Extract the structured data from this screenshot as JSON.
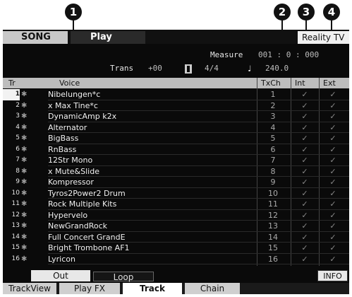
{
  "callouts": [
    "1",
    "2",
    "3",
    "4"
  ],
  "header": {
    "mode": "SONG",
    "submode": "Play",
    "song_name": "Reality TV"
  },
  "measure": {
    "label": "Measure",
    "value": "001 : 0 : 000"
  },
  "transport": {
    "trans_label": "Trans",
    "trans_value": "+00",
    "meter": "4/4",
    "tempo": "240.0"
  },
  "columns": {
    "tr": "Tr",
    "voice": "Voice",
    "txch": "TxCh",
    "int": "Int",
    "ext": "Ext"
  },
  "tracks": [
    {
      "num": "1",
      "voice": "Nibelungen*c",
      "ch": "1",
      "int": "✓",
      "ext": "✓"
    },
    {
      "num": "2",
      "voice": "x Max Tine*c",
      "ch": "2",
      "int": "✓",
      "ext": "✓"
    },
    {
      "num": "3",
      "voice": "DynamicAmp k2x",
      "ch": "3",
      "int": "✓",
      "ext": "✓"
    },
    {
      "num": "4",
      "voice": "Alternator",
      "ch": "4",
      "int": "✓",
      "ext": "✓"
    },
    {
      "num": "5",
      "voice": "BigBass",
      "ch": "5",
      "int": "✓",
      "ext": "✓"
    },
    {
      "num": "6",
      "voice": "RnBass",
      "ch": "6",
      "int": "✓",
      "ext": "✓"
    },
    {
      "num": "7",
      "voice": "12Str Mono",
      "ch": "7",
      "int": "✓",
      "ext": "✓"
    },
    {
      "num": "8",
      "voice": "x Mute&Slide",
      "ch": "8",
      "int": "✓",
      "ext": "✓"
    },
    {
      "num": "9",
      "voice": "Kompressor",
      "ch": "9",
      "int": "✓",
      "ext": "✓"
    },
    {
      "num": "10",
      "voice": "Tyros2Power2 Drum",
      "ch": "10",
      "int": "✓",
      "ext": "✓"
    },
    {
      "num": "11",
      "voice": "Rock Multiple Kits",
      "ch": "11",
      "int": "✓",
      "ext": "✓"
    },
    {
      "num": "12",
      "voice": "Hypervelo",
      "ch": "12",
      "int": "✓",
      "ext": "✓"
    },
    {
      "num": "13",
      "voice": "NewGrandRock",
      "ch": "13",
      "int": "✓",
      "ext": "✓"
    },
    {
      "num": "14",
      "voice": "Full Concert GrandE",
      "ch": "14",
      "int": "✓",
      "ext": "✓"
    },
    {
      "num": "15",
      "voice": "Bright Trombone AF1",
      "ch": "15",
      "int": "✓",
      "ext": "✓"
    },
    {
      "num": "16",
      "voice": "Lyricon",
      "ch": "16",
      "int": "✓",
      "ext": "✓"
    }
  ],
  "subtabs": {
    "out": "Out",
    "loop": "Loop",
    "info": "INFO"
  },
  "footer_tabs": [
    "TrackView",
    "Play FX",
    "Track",
    "Chain"
  ]
}
